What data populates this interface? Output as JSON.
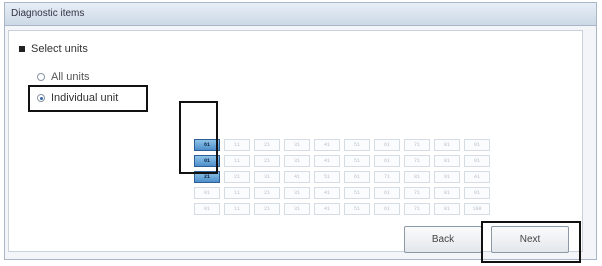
{
  "window": {
    "title": "Diagnostic items"
  },
  "select_units": {
    "heading": "Select units",
    "options": [
      {
        "label": "All units",
        "checked": false
      },
      {
        "label": "Individual unit",
        "checked": true
      }
    ]
  },
  "unit_grid": {
    "rows": [
      [
        "01",
        "11",
        "21",
        "31",
        "41",
        "51",
        "61",
        "71",
        "81",
        "91"
      ],
      [
        "01",
        "11",
        "21",
        "31",
        "41",
        "51",
        "61",
        "71",
        "81",
        "91"
      ],
      [
        "21",
        "21",
        "31",
        "41",
        "51",
        "61",
        "71",
        "81",
        "91",
        "A1"
      ],
      [
        "01",
        "11",
        "21",
        "31",
        "41",
        "51",
        "61",
        "71",
        "81",
        "91"
      ],
      [
        "01",
        "11",
        "21",
        "31",
        "41",
        "51",
        "61",
        "71",
        "81",
        "100"
      ]
    ],
    "selected_labels": [
      "61",
      "01",
      "21"
    ]
  },
  "buttons": {
    "back": "Back",
    "next": "Next"
  }
}
